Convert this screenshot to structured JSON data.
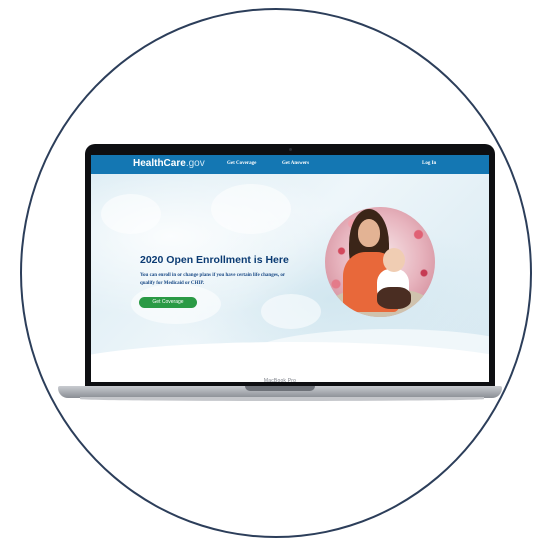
{
  "site": {
    "logo_main": "HealthCare",
    "logo_suffix": ".gov"
  },
  "nav": {
    "get_coverage": "Get Coverage",
    "get_answers": "Get Answers",
    "log_in": "Log In"
  },
  "hero": {
    "headline": "2020 Open Enrollment is Here",
    "subtext": "You can enroll in or change plans if you have certain life changes, or qualify for Medicaid or CHIP.",
    "cta_label": "Get Coverage"
  },
  "device": {
    "model_label": "MacBook Pro"
  },
  "colors": {
    "nav_bg": "#1477b3",
    "headline": "#0b3b73",
    "cta_bg": "#2a9a45",
    "frame": "#2c3e5a"
  }
}
